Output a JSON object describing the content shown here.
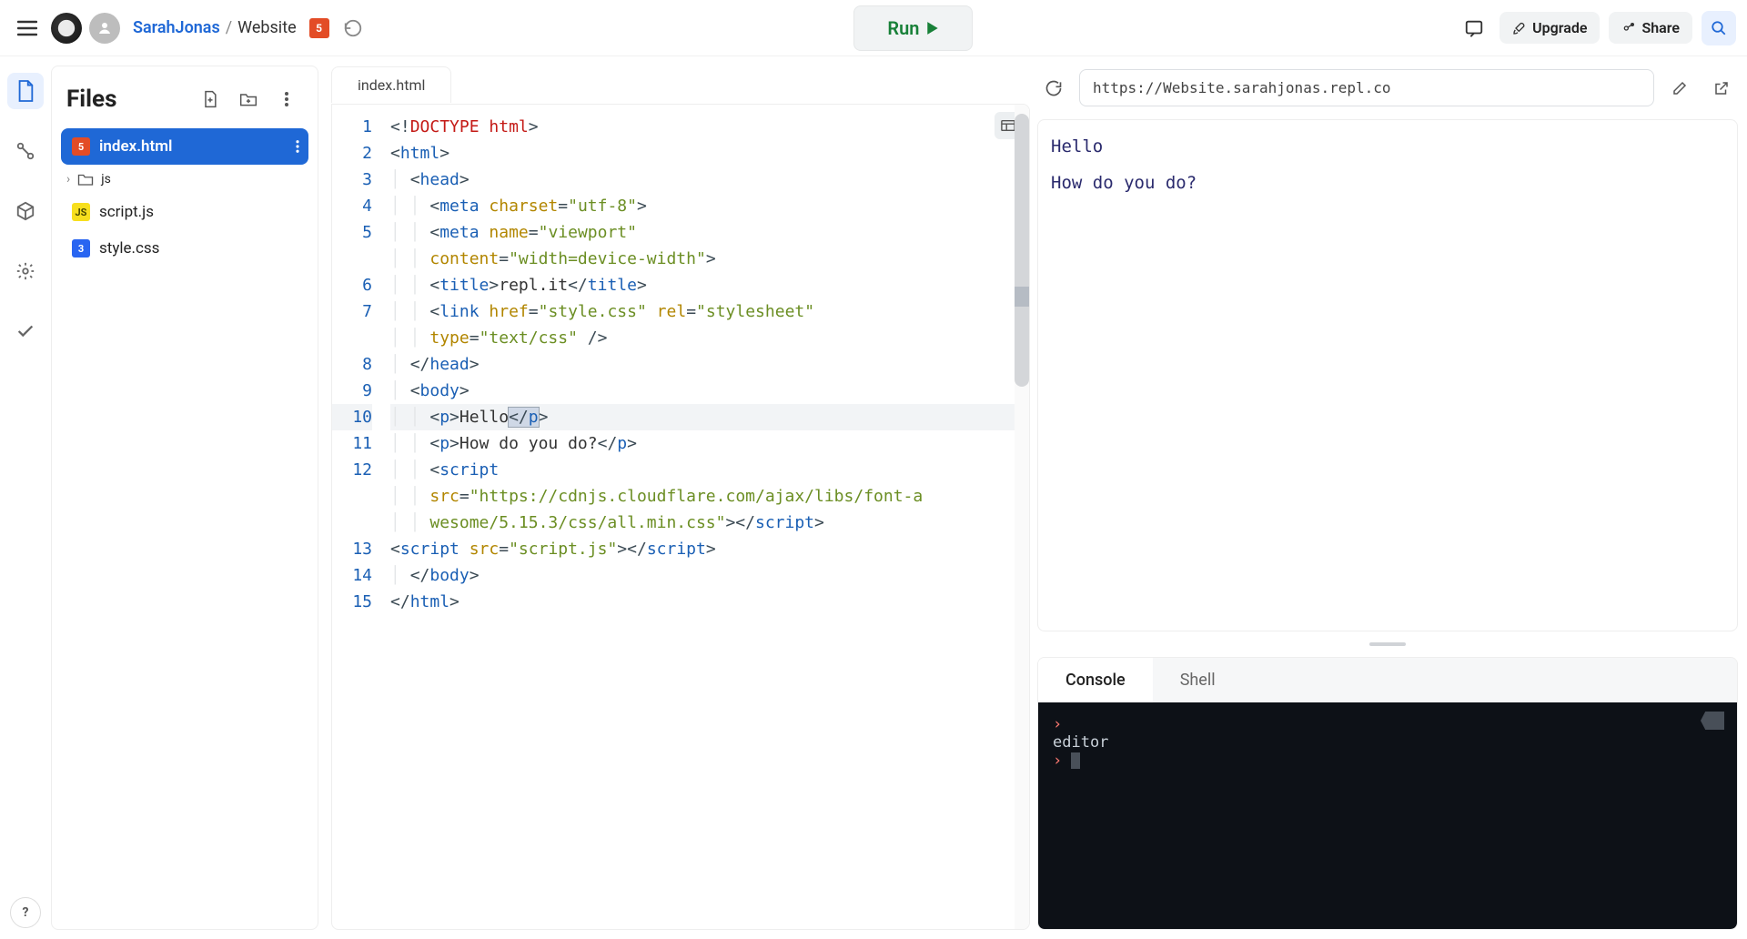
{
  "header": {
    "user": "SarahJonas",
    "separator": "/",
    "project": "Website",
    "run_label": "Run",
    "upgrade_label": "Upgrade",
    "share_label": "Share"
  },
  "files_panel": {
    "title": "Files",
    "items": [
      {
        "name": "index.html",
        "icon": "html5",
        "active": true
      },
      {
        "name": "js",
        "icon": "folder",
        "is_folder": true
      },
      {
        "name": "script.js",
        "icon": "js"
      },
      {
        "name": "style.css",
        "icon": "css"
      }
    ]
  },
  "editor": {
    "tab_label": "index.html",
    "active_line": 10,
    "lines": [
      {
        "n": 1,
        "indent": 0,
        "tokens": [
          [
            "punc",
            "<!"
          ],
          [
            "kw",
            "DOCTYPE"
          ],
          [
            "txt",
            " "
          ],
          [
            "kw",
            "html"
          ],
          [
            "punc",
            ">"
          ]
        ]
      },
      {
        "n": 2,
        "indent": 0,
        "tokens": [
          [
            "punc",
            "<"
          ],
          [
            "tag",
            "html"
          ],
          [
            "punc",
            ">"
          ]
        ]
      },
      {
        "n": 3,
        "indent": 1,
        "tokens": [
          [
            "punc",
            "<"
          ],
          [
            "tag",
            "head"
          ],
          [
            "punc",
            ">"
          ]
        ]
      },
      {
        "n": 4,
        "indent": 2,
        "tokens": [
          [
            "punc",
            "<"
          ],
          [
            "tag",
            "meta"
          ],
          [
            "txt",
            " "
          ],
          [
            "attr",
            "charset"
          ],
          [
            "punc",
            "="
          ],
          [
            "str",
            "\"utf-8\""
          ],
          [
            "punc",
            ">"
          ]
        ]
      },
      {
        "n": 5,
        "indent": 2,
        "wrap": true,
        "tokens": [
          [
            "punc",
            "<"
          ],
          [
            "tag",
            "meta"
          ],
          [
            "txt",
            " "
          ],
          [
            "attr",
            "name"
          ],
          [
            "punc",
            "="
          ],
          [
            "str",
            "\"viewport\""
          ],
          [
            "txt",
            " "
          ],
          [
            "br",
            ""
          ],
          [
            "attr",
            "content"
          ],
          [
            "punc",
            "="
          ],
          [
            "str",
            "\"width=device-width\""
          ],
          [
            "punc",
            ">"
          ]
        ]
      },
      {
        "n": 6,
        "indent": 2,
        "tokens": [
          [
            "punc",
            "<"
          ],
          [
            "tag",
            "title"
          ],
          [
            "punc",
            ">"
          ],
          [
            "txt",
            "repl.it"
          ],
          [
            "punc",
            "</"
          ],
          [
            "tag",
            "title"
          ],
          [
            "punc",
            ">"
          ]
        ]
      },
      {
        "n": 7,
        "indent": 2,
        "wrap": true,
        "tokens": [
          [
            "punc",
            "<"
          ],
          [
            "tag",
            "link"
          ],
          [
            "txt",
            " "
          ],
          [
            "attr",
            "href"
          ],
          [
            "punc",
            "="
          ],
          [
            "str",
            "\"style.css\""
          ],
          [
            "txt",
            " "
          ],
          [
            "attr",
            "rel"
          ],
          [
            "punc",
            "="
          ],
          [
            "str",
            "\"stylesheet\""
          ],
          [
            "txt",
            " "
          ],
          [
            "br",
            ""
          ],
          [
            "attr",
            "type"
          ],
          [
            "punc",
            "="
          ],
          [
            "str",
            "\"text/css\""
          ],
          [
            "txt",
            " "
          ],
          [
            "punc",
            "/>"
          ]
        ]
      },
      {
        "n": 8,
        "indent": 1,
        "tokens": [
          [
            "punc",
            "</"
          ],
          [
            "tag",
            "head"
          ],
          [
            "punc",
            ">"
          ]
        ]
      },
      {
        "n": 9,
        "indent": 1,
        "tokens": [
          [
            "punc",
            "<"
          ],
          [
            "tag",
            "body"
          ],
          [
            "punc",
            ">"
          ]
        ]
      },
      {
        "n": 10,
        "indent": 2,
        "hl": true,
        "tokens": [
          [
            "punc",
            "<"
          ],
          [
            "tag",
            "p"
          ],
          [
            "punc",
            ">"
          ],
          [
            "txt",
            "Hello"
          ],
          [
            "selstart",
            ""
          ],
          [
            "punc",
            "</"
          ],
          [
            "tag",
            "p"
          ],
          [
            "selend",
            ""
          ],
          [
            "punc",
            ">"
          ]
        ]
      },
      {
        "n": 11,
        "indent": 2,
        "tokens": [
          [
            "punc",
            "<"
          ],
          [
            "tag",
            "p"
          ],
          [
            "punc",
            ">"
          ],
          [
            "txt",
            "How do you do?"
          ],
          [
            "punc",
            "</"
          ],
          [
            "tag",
            "p"
          ],
          [
            "punc",
            ">"
          ]
        ]
      },
      {
        "n": 12,
        "indent": 2,
        "wrap": true,
        "tokens": [
          [
            "punc",
            "<"
          ],
          [
            "tag",
            "script"
          ],
          [
            "txt",
            " "
          ],
          [
            "br",
            ""
          ],
          [
            "attr",
            "src"
          ],
          [
            "punc",
            "="
          ],
          [
            "str",
            "\"https://cdnjs.cloudflare.com/ajax/libs/font-a"
          ],
          [
            "br2",
            ""
          ],
          [
            "str",
            "wesome/5.15.3/css/all.min.css\""
          ],
          [
            "punc",
            "></"
          ],
          [
            "tag",
            "script"
          ],
          [
            "punc",
            ">"
          ]
        ]
      },
      {
        "n": 13,
        "indent": 0,
        "tokens": [
          [
            "punc",
            "<"
          ],
          [
            "tag",
            "script"
          ],
          [
            "txt",
            " "
          ],
          [
            "attr",
            "src"
          ],
          [
            "punc",
            "="
          ],
          [
            "str",
            "\"script.js\""
          ],
          [
            "punc",
            "></"
          ],
          [
            "tag",
            "script"
          ],
          [
            "punc",
            ">"
          ]
        ]
      },
      {
        "n": 14,
        "indent": 1,
        "tokens": [
          [
            "punc",
            "</"
          ],
          [
            "tag",
            "body"
          ],
          [
            "punc",
            ">"
          ]
        ]
      },
      {
        "n": 15,
        "indent": 0,
        "tokens": [
          [
            "punc",
            "</"
          ],
          [
            "tag",
            "html"
          ],
          [
            "punc",
            ">"
          ]
        ]
      }
    ]
  },
  "preview": {
    "url": "https://Website.sarahjonas.repl.co",
    "content": [
      "Hello",
      "How do you do?"
    ]
  },
  "console": {
    "tabs": [
      "Console",
      "Shell"
    ],
    "active_tab": 0,
    "lines": [
      "editor"
    ]
  }
}
